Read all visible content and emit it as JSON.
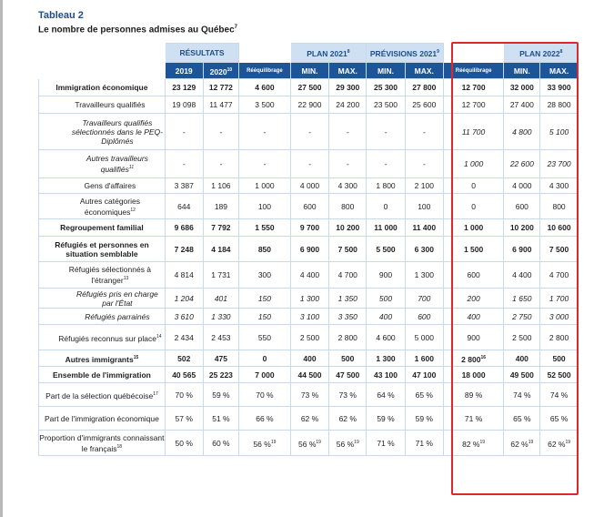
{
  "caption": {
    "label": "Tableau 2",
    "title": "Le nombre de personnes admises au Québec",
    "title_note": "7"
  },
  "header_groups": {
    "resultats": "RÉSULTATS",
    "plan2021": "PLAN 2021",
    "plan2021_note": "8",
    "previsions2021": "PRÉVISIONS 2021",
    "previsions2021_note": "9",
    "plan2022": "PLAN 2022",
    "plan2022_note": "8"
  },
  "header_cols": {
    "y2019": "2019",
    "y2020": "2020",
    "y2020_note": "10",
    "reequilibrage": "Rééquilibrage",
    "min1": "MIN.",
    "max1": "MAX.",
    "min2": "MIN.",
    "max2": "MAX.",
    "reequilibrage2": "Rééquilibrage",
    "min3": "MIN.",
    "max3": "MAX."
  },
  "rows": [
    {
      "label": "Immigration économique",
      "note": "",
      "cells": [
        "23 129",
        "12 772",
        "4 600",
        "27 500",
        "29 300",
        "25 300",
        "27 800",
        "12 700",
        "32 000",
        "33 900"
      ]
    },
    {
      "label": "Travailleurs qualifiés",
      "note": "",
      "cells": [
        "19 098",
        "11 477",
        "3 500",
        "22 900",
        "24 200",
        "23 500",
        "25 600",
        "12 700",
        "27 400",
        "28 800"
      ]
    },
    {
      "label": "Travailleurs qualifiés sélectionnés dans le PEQ-Diplômés",
      "note": "",
      "cells": [
        "-",
        "-",
        "-",
        "-",
        "-",
        "-",
        "-",
        "11 700",
        "4 800",
        "5 100"
      ]
    },
    {
      "label": "Autres travailleurs qualifiés",
      "note": "11",
      "cells": [
        "-",
        "-",
        "-",
        "-",
        "-",
        "-",
        "-",
        "1 000",
        "22 600",
        "23 700"
      ]
    },
    {
      "label": "Gens d'affaires",
      "note": "",
      "cells": [
        "3 387",
        "1 106",
        "1 000",
        "4 000",
        "4 300",
        "1 800",
        "2 100",
        "0",
        "4 000",
        "4 300"
      ]
    },
    {
      "label": "Autres catégories économiques",
      "note": "12",
      "cells": [
        "644",
        "189",
        "100",
        "600",
        "800",
        "0",
        "100",
        "0",
        "600",
        "800"
      ]
    },
    {
      "label": "Regroupement familial",
      "note": "",
      "cells": [
        "9 686",
        "7 792",
        "1 550",
        "9 700",
        "10 200",
        "11 000",
        "11 400",
        "1 000",
        "10 200",
        "10 600"
      ]
    },
    {
      "label": "Réfugiés et personnes en situation semblable",
      "note": "",
      "cells": [
        "7 248",
        "4 184",
        "850",
        "6 900",
        "7 500",
        "5 500",
        "6 300",
        "1 500",
        "6 900",
        "7 500"
      ]
    },
    {
      "label": "Réfugiés sélectionnés à l'étranger",
      "note": "13",
      "cells": [
        "4 814",
        "1 731",
        "300",
        "4 400",
        "4 700",
        "900",
        "1 300",
        "600",
        "4 400",
        "4 700"
      ]
    },
    {
      "label": "Réfugiés pris en charge par l'État",
      "note": "",
      "cells": [
        "1 204",
        "401",
        "150",
        "1 300",
        "1 350",
        "500",
        "700",
        "200",
        "1 650",
        "1 700"
      ]
    },
    {
      "label": "Réfugiés parrainés",
      "note": "",
      "cells": [
        "3 610",
        "1 330",
        "150",
        "3 100",
        "3 350",
        "400",
        "600",
        "400",
        "2 750",
        "3 000"
      ]
    },
    {
      "label": "Réfugiés reconnus sur place",
      "note": "14",
      "cells": [
        "2 434",
        "2 453",
        "550",
        "2 500",
        "2 800",
        "4 600",
        "5 000",
        "900",
        "2 500",
        "2 800"
      ]
    },
    {
      "label": "Autres immigrants",
      "note": "15",
      "cells": [
        "502",
        "475",
        "0",
        "400",
        "500",
        "1 300",
        "1 600",
        "2 800",
        "400",
        "500"
      ],
      "cell_notes": {
        "7": "16"
      }
    },
    {
      "label": "Ensemble de l'immigration",
      "note": "",
      "cells": [
        "40 565",
        "25 223",
        "7 000",
        "44 500",
        "47 500",
        "43 100",
        "47 100",
        "18 000",
        "49 500",
        "52 500"
      ]
    },
    {
      "label": "Part de la sélection québécoise",
      "note": "17",
      "cells": [
        "70 %",
        "59 %",
        "70 %",
        "73 %",
        "73 %",
        "64 %",
        "65 %",
        "89 %",
        "74 %",
        "74 %"
      ]
    },
    {
      "label": "Part de l'immigration économique",
      "note": "",
      "cells": [
        "57 %",
        "51 %",
        "66 %",
        "62 %",
        "62 %",
        "59 %",
        "59 %",
        "71 %",
        "65 %",
        "65 %"
      ]
    },
    {
      "label": "Proportion d'immigrants connaissant le français",
      "note": "18",
      "cells": [
        "50 %",
        "60 %",
        "56 %",
        "56 %",
        "56 %",
        "71 %",
        "71 %",
        "82 %",
        "62 %",
        "62 %"
      ],
      "cell_notes": {
        "2": "19",
        "3": "19",
        "4": "19",
        "7": "19",
        "8": "19",
        "9": "19"
      }
    }
  ],
  "highlight_color": "#e0282b",
  "header_color": "#1d5599",
  "subheader_color": "#cfe0f3"
}
